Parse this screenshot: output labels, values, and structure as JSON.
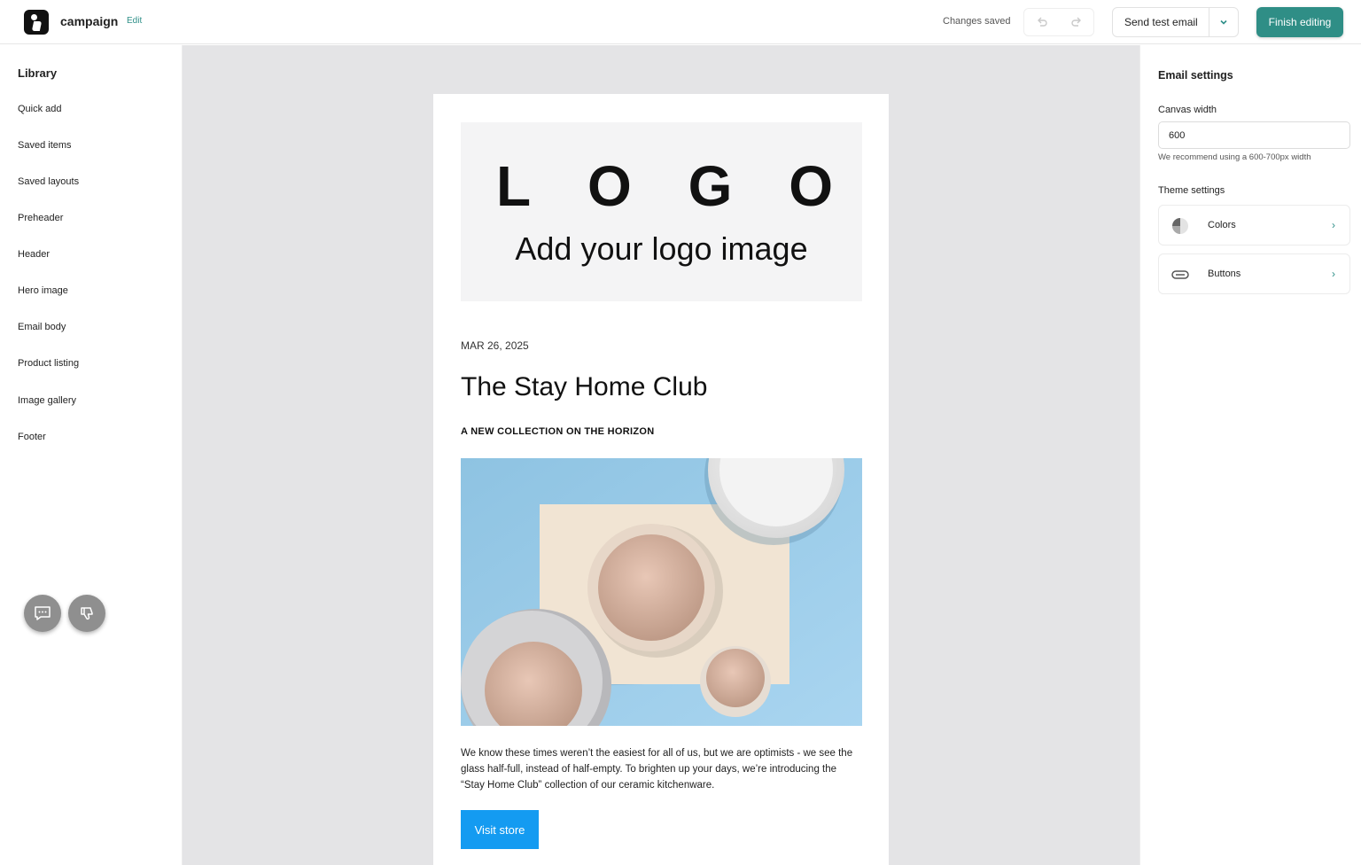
{
  "header": {
    "app_name": "campaign",
    "edit_label": "Edit",
    "status": "Changes saved",
    "send_test_label": "Send test email",
    "finish_label": "Finish editing"
  },
  "sidebar": {
    "title": "Library",
    "items": [
      {
        "label": "Quick add"
      },
      {
        "label": "Saved items"
      },
      {
        "label": "Saved layouts"
      },
      {
        "label": "Preheader"
      },
      {
        "label": "Header"
      },
      {
        "label": "Hero image"
      },
      {
        "label": "Email body"
      },
      {
        "label": "Product listing"
      },
      {
        "label": "Image gallery"
      },
      {
        "label": "Footer"
      }
    ],
    "fab_icons": [
      "feedback-chat-icon",
      "thumbs-down-icon"
    ]
  },
  "email": {
    "logo_letters": [
      "L",
      "O",
      "G",
      "O"
    ],
    "logo_subtitle": "Add your logo image",
    "date": "MAR 26, 2025",
    "headline": "The Stay Home Club",
    "subheadline": "A NEW COLLECTION ON THE HORIZON",
    "body": "We know these times weren’t the easiest for all of us, but we are optimists - we see the glass half-full, instead of half-empty. To brighten up your days, we’re introducing the “Stay Home Club” collection of our ceramic kitchenware.",
    "cta_label": "Visit store",
    "cta_color": "#149bf1"
  },
  "settings": {
    "title": "Email settings",
    "canvas_width_label": "Canvas width",
    "canvas_width_value": "600",
    "canvas_hint": "We recommend using a 600-700px width",
    "theme_label": "Theme settings",
    "theme_cards": [
      {
        "label": "Colors",
        "icon": "color-palette-icon"
      },
      {
        "label": "Buttons",
        "icon": "button-shape-icon"
      }
    ]
  },
  "colors": {
    "accent": "#2f8e86",
    "canvas_bg": "#e4e4e6"
  }
}
